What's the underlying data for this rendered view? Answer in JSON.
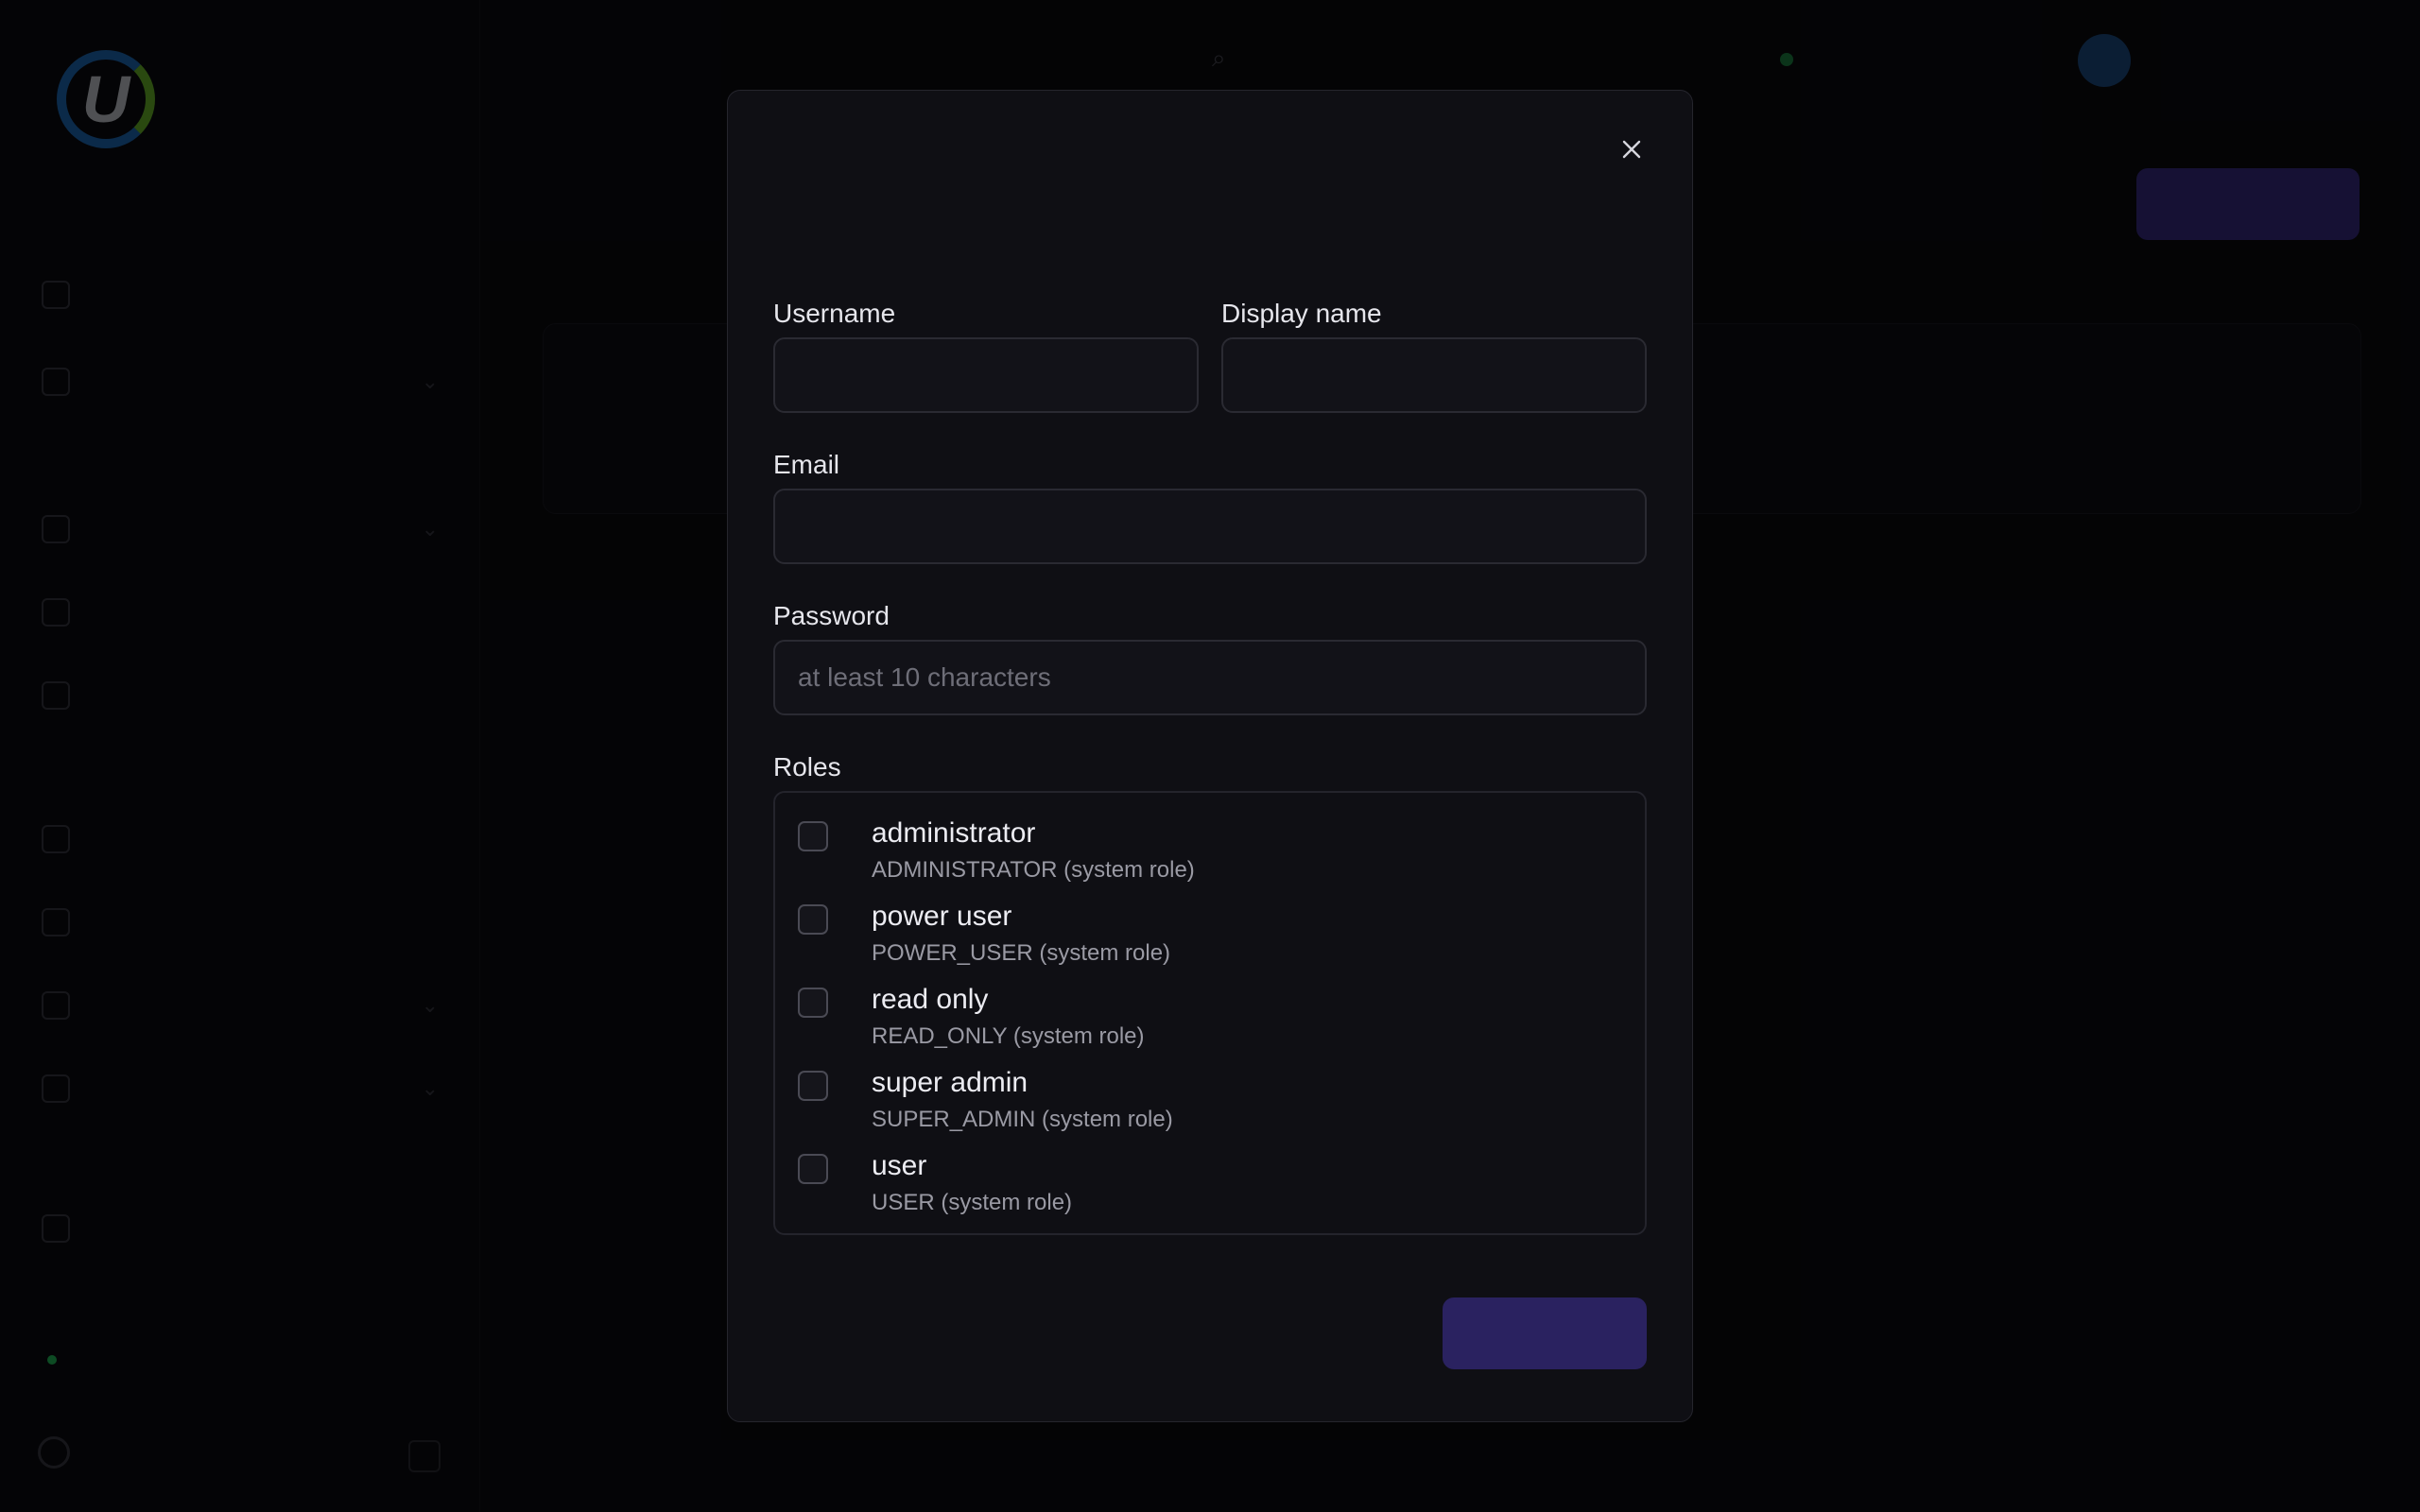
{
  "modal": {
    "title": "",
    "subtitle": "",
    "fields": {
      "username": {
        "label": "Username",
        "value": "",
        "placeholder": ""
      },
      "display_name": {
        "label": "Display name",
        "value": "",
        "placeholder": ""
      },
      "email": {
        "label": "Email",
        "value": "",
        "placeholder": ""
      },
      "password": {
        "label": "Password",
        "value": "",
        "placeholder": "at least 10 characters"
      }
    },
    "roles_label": "Roles",
    "roles": [
      {
        "name": "administrator",
        "desc": "ADMINISTRATOR (system role)",
        "checked": false
      },
      {
        "name": "power user",
        "desc": "POWER_USER (system role)",
        "checked": false
      },
      {
        "name": "read only",
        "desc": "READ_ONLY (system role)",
        "checked": false
      },
      {
        "name": "super admin",
        "desc": "SUPER_ADMIN (system role)",
        "checked": false
      },
      {
        "name": "user",
        "desc": "USER (system role)",
        "checked": false
      }
    ],
    "cancel_label": "",
    "create_label": ""
  },
  "icons": {
    "close": "close-icon",
    "checkbox": "checkbox-unchecked"
  },
  "colors": {
    "background": "#0b0b0f",
    "modal_bg": "#0f0f14",
    "accent": "#3b2f8a",
    "text": "#e6e6ec",
    "muted_text": "#9a9aa4"
  }
}
